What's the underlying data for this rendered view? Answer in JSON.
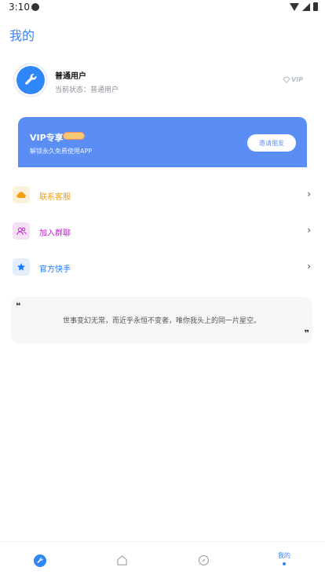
{
  "status_bar": {
    "time": "3:10"
  },
  "header": {
    "title": "我的"
  },
  "profile": {
    "username": "普通用户",
    "status": "当前状态：普通用户",
    "badge": "VIP"
  },
  "vip_card": {
    "title": "VIP专享",
    "subtitle": "解锁永久免费使用APP",
    "button": "邀请朋友"
  },
  "menu": [
    {
      "label": "联系客服",
      "icon": "cloud-icon",
      "color": "#f59e0b",
      "bg": "#fdf1dc"
    },
    {
      "label": "加入群聊",
      "icon": "group-icon",
      "color": "#c026d3",
      "bg": "#f4e1f5"
    },
    {
      "label": "官方快手",
      "icon": "star-icon",
      "color": "#1677ff",
      "bg": "#e3eefb"
    }
  ],
  "quote": {
    "text": "世事变幻无常，而近乎永恒不变者，唯你我头上的同一片星空。"
  },
  "tabbar": {
    "items": [
      {
        "icon": "wrench-icon",
        "active": true
      },
      {
        "icon": "home-icon"
      },
      {
        "icon": "compass-icon"
      },
      {
        "label": "我的",
        "active": true
      }
    ]
  },
  "colors": {
    "accent": "#3b82f6",
    "vip_card": "#5b8ef5"
  }
}
